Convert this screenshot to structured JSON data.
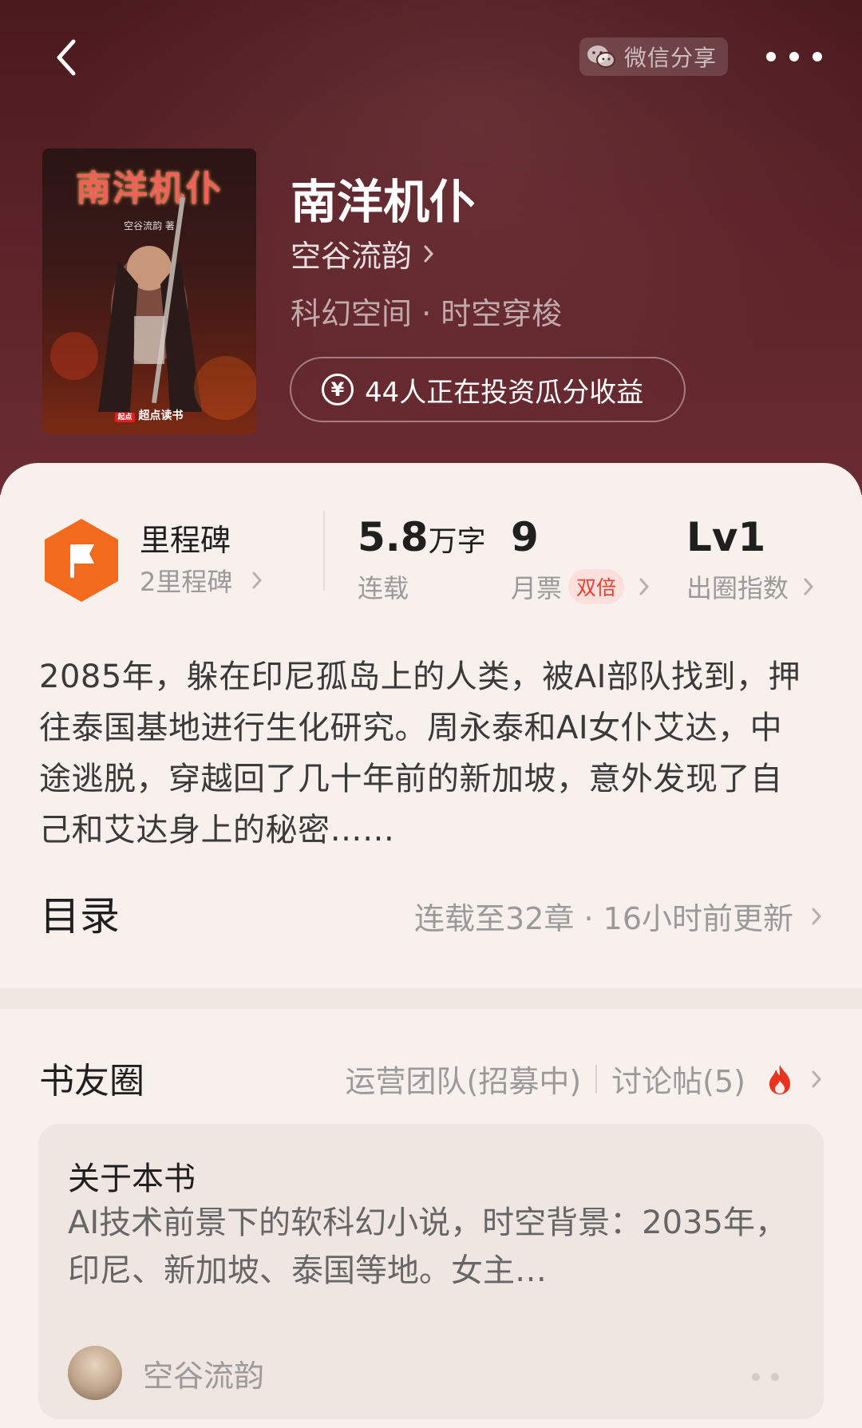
{
  "header": {
    "share_label": "微信分享"
  },
  "book": {
    "title": "南洋机仆",
    "author": "空谷流韵",
    "genre": "科幻空间 · 时空穿梭",
    "invest_label": "44人正在投资瓜分收益",
    "cover_title": "南洋机仆",
    "cover_author": "空谷流韵 著",
    "cover_publisher": "超点读书"
  },
  "stats": {
    "milestone_title": "里程碑",
    "milestone_sub": "2里程碑",
    "words_value": "5.8",
    "words_unit": "万字",
    "words_label": "连载",
    "tickets_value": "9",
    "tickets_label": "月票",
    "tickets_badge": "双倍",
    "index_value": "Lv1",
    "index_label": "出圈指数"
  },
  "synopsis": "2085年，躲在印尼孤岛上的人类，被AI部队找到，押往泰国基地进行生化研究。周永泰和AI女仆艾达，中途逃脱，穿越回了几十年前的新加坡，意外发现了自己和艾达身上的秘密……",
  "toc": {
    "title": "目录",
    "info": "连载至32章 · 16小时前更新"
  },
  "circle": {
    "title": "书友圈",
    "link_ops": "运营团队(招募中)",
    "link_posts": "讨论帖(5)",
    "about_title": "关于本书",
    "about_text": "AI技术前景下的软科幻小说，时空背景：2035年，印尼、新加坡、泰国等地。女主…",
    "about_author": "空谷流韵"
  },
  "colors": {
    "hero_bg": "#5a2228",
    "accent_orange": "#f26a1b",
    "badge_red": "#e8412f"
  }
}
